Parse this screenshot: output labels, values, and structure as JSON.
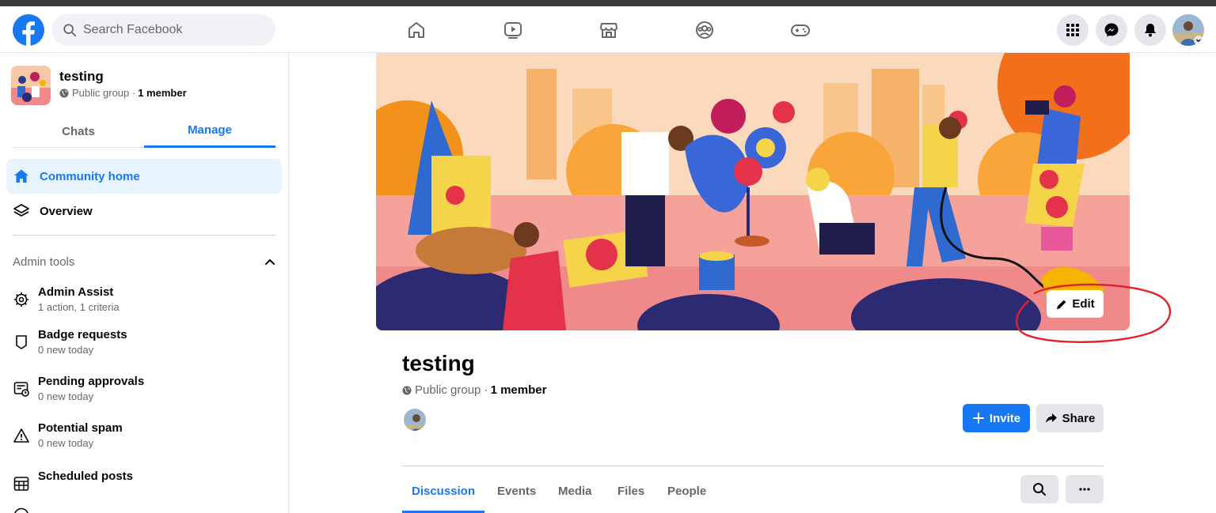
{
  "search": {
    "placeholder": "Search Facebook"
  },
  "nav": {
    "icons": [
      "home-icon",
      "watch-icon",
      "marketplace-icon",
      "groups-icon",
      "gaming-icon"
    ],
    "right": [
      "menu-grid-icon",
      "messenger-icon",
      "notifications-icon",
      "account-avatar"
    ]
  },
  "sidebar": {
    "group_name": "testing",
    "group_privacy": "Public group ·",
    "group_members": "1 member",
    "tabs": [
      "Chats",
      "Manage"
    ],
    "active_tab": "Manage",
    "items": [
      {
        "label": "Community home",
        "icon": "home-icon",
        "active": true
      },
      {
        "label": "Overview",
        "icon": "layers-icon",
        "active": false
      }
    ],
    "admin_tools_label": "Admin tools",
    "tools": [
      {
        "title": "Admin Assist",
        "sub": "1 action, 1 criteria",
        "icon": "admin-assist-icon"
      },
      {
        "title": "Badge requests",
        "sub": "0 new today",
        "icon": "badge-icon"
      },
      {
        "title": "Pending approvals",
        "sub": "0 new today",
        "icon": "pending-approvals-icon"
      },
      {
        "title": "Potential spam",
        "sub": "0 new today",
        "icon": "warning-icon"
      },
      {
        "title": "Scheduled posts",
        "sub": "",
        "icon": "calendar-icon"
      }
    ]
  },
  "group": {
    "title": "testing",
    "privacy": "Public group ·",
    "members": "1 member",
    "edit_label": "Edit",
    "invite_label": "Invite",
    "share_label": "Share",
    "tabs": [
      "Discussion",
      "Events",
      "Media",
      "Files",
      "People"
    ],
    "active_tab": "Discussion"
  },
  "colors": {
    "accent": "#1877f2",
    "annotation": "#e0202a"
  }
}
